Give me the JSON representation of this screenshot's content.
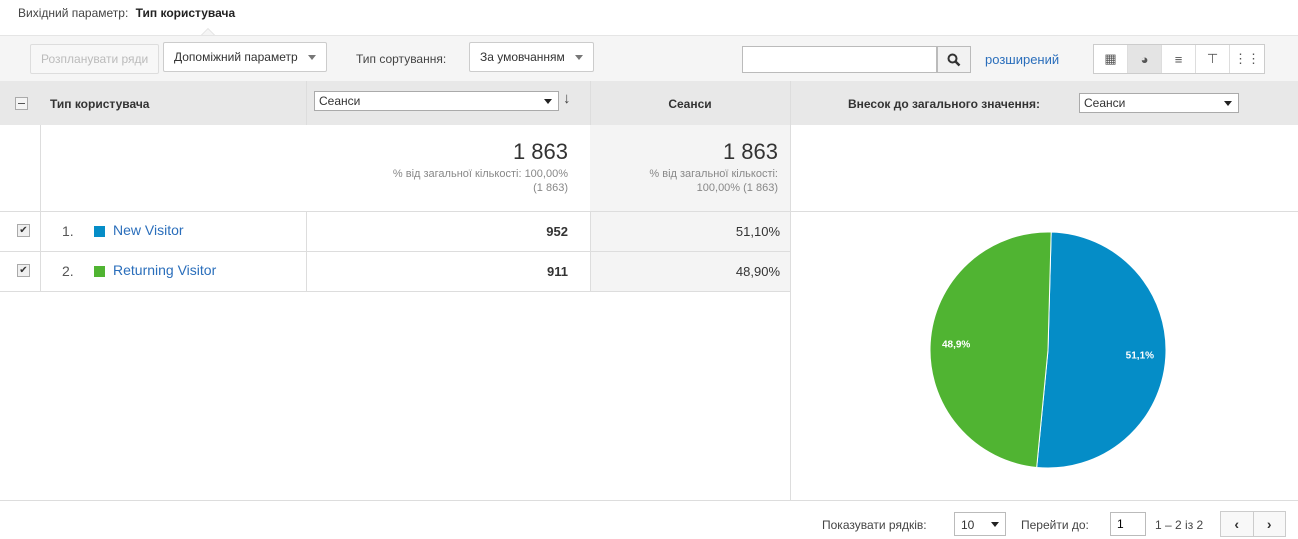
{
  "primary_dimension": {
    "label": "Вихідний параметр:",
    "value": "Тип користувача"
  },
  "toolbar": {
    "plot_rows": "Розпланувати ряди",
    "secondary_dimension": "Допоміжний параметр",
    "sort_type_label": "Тип сортування:",
    "sort_type_value": "За умовчанням",
    "search_placeholder": "",
    "advanced": "розширений"
  },
  "table": {
    "header": {
      "dimension": "Тип користувача",
      "metric_select": "Сеанси",
      "metric2": "Сеанси",
      "contribution_label": "Внесок до загального значення:",
      "contribution_select": "Сеанси"
    },
    "totals": {
      "sessions": "1 863",
      "sessions_note1": "% від загальної кількості: 100,00%",
      "sessions_note2": "(1 863)",
      "sessions2": "1 863",
      "sessions2_note1": "% від загальної кількості:",
      "sessions2_note2": "100,00% (1 863)"
    },
    "rows": [
      {
        "num": "1.",
        "name": "New Visitor",
        "color": "#058dc7",
        "sessions": "952",
        "percent": "51,10%"
      },
      {
        "num": "2.",
        "name": "Returning Visitor",
        "color": "#50b432",
        "sessions": "911",
        "percent": "48,90%"
      }
    ]
  },
  "chart_data": {
    "type": "pie",
    "labels": [
      "New Visitor",
      "Returning Visitor"
    ],
    "values": [
      51.1,
      48.9
    ],
    "colors": [
      "#058dc7",
      "#50b432"
    ],
    "slice_labels": [
      "51,1%",
      "48,9%"
    ]
  },
  "footer": {
    "rows_label": "Показувати рядків:",
    "rows_value": "10",
    "goto_label": "Перейти до:",
    "goto_value": "1",
    "range": "1 – 2 із 2"
  }
}
